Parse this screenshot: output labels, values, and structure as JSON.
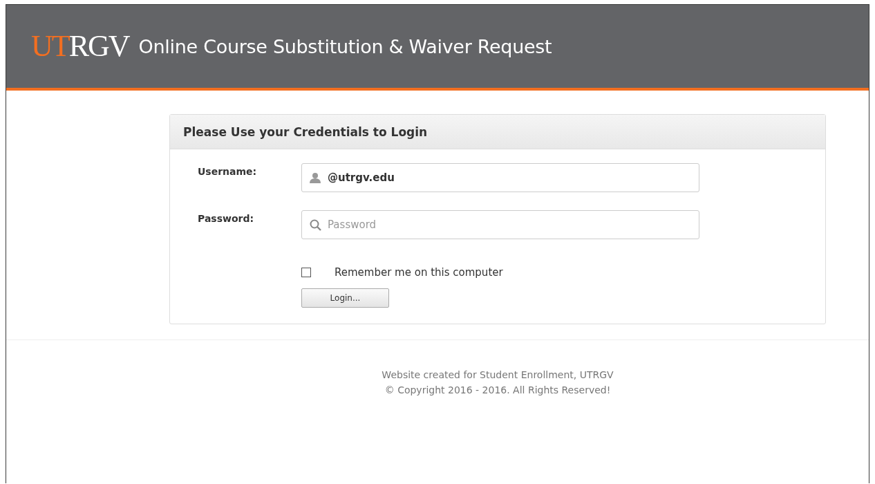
{
  "header": {
    "logo": {
      "accent": "UT",
      "rest": "RGV"
    },
    "title": "Online Course Substitution & Waiver Request"
  },
  "login_panel": {
    "title": "Please Use your Credentials to Login",
    "fields": [
      {
        "label": "Username:",
        "kind": "user",
        "value": "@utrgv.edu"
      },
      {
        "label": "Password:",
        "kind": "password",
        "placeholder": "Password"
      }
    ],
    "remember": {
      "label": "Remember me on this computer",
      "checked": false
    },
    "button": "Login..."
  },
  "footer": [
    "Website created for Student Enrollment, UTRGV",
    "© Copyright 2016 - 2016. All Rights Reserved!"
  ]
}
